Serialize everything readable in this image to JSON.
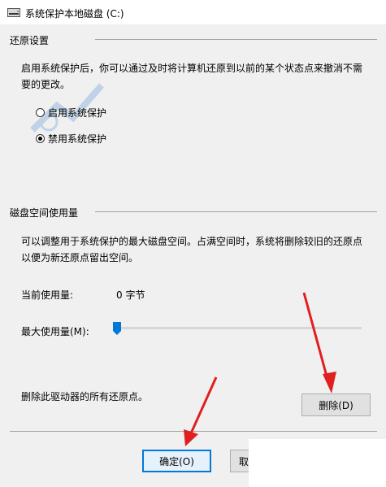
{
  "window": {
    "title": "系统保护本地磁盘 (C:)"
  },
  "restore_settings": {
    "header": "还原设置",
    "description": "启用系统保护后，你可以通过及时将计算机还原到以前的某个状态点来撤消不需要的更改。",
    "options": [
      {
        "label": "启用系统保护",
        "checked": false
      },
      {
        "label": "禁用系统保护",
        "checked": true
      }
    ]
  },
  "disk_usage": {
    "header": "磁盘空间使用量",
    "description": "可以调整用于系统保护的最大磁盘空间。占满空间时，系统将删除较旧的还原点以便为新还原点留出空间。",
    "current_label": "当前使用量:",
    "current_value": "0 字节",
    "max_label": "最大使用量(M):",
    "max_usage_fraction": 0.0,
    "delete_text": "删除此驱动器的所有还原点。",
    "delete_button": "删除(D)"
  },
  "footer": {
    "ok_button": "确定(O)",
    "cancel_button": "取"
  },
  "colors": {
    "accent": "#0078d7",
    "annotation_arrow": "#e02020"
  }
}
